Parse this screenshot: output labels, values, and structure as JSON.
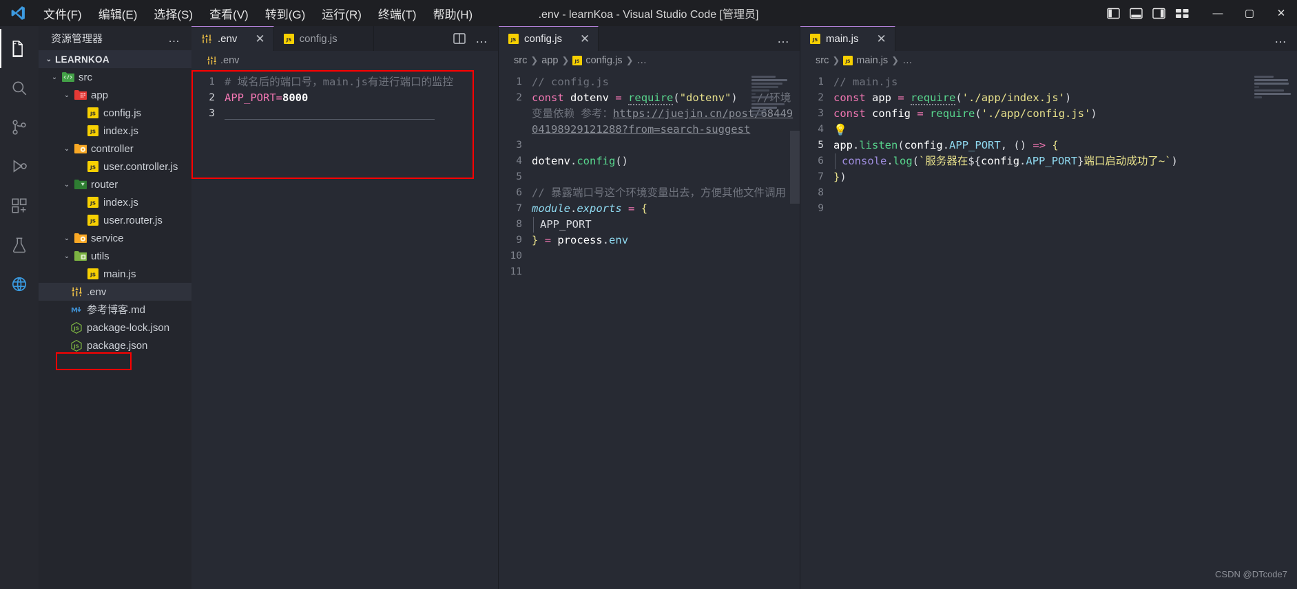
{
  "titlebar": {
    "app_icon": "vscode-logo-icon",
    "menus": [
      "文件(F)",
      "编辑(E)",
      "选择(S)",
      "查看(V)",
      "转到(G)",
      "运行(R)",
      "终端(T)",
      "帮助(H)"
    ],
    "window_title": ".env - learnKoa - Visual Studio Code [管理员]",
    "layout_icons": [
      "toggle-primary-sidebar-icon",
      "toggle-panel-icon",
      "toggle-secondary-sidebar-icon",
      "customize-layout-icon"
    ],
    "window_controls": {
      "minimize": "—",
      "maximize": "▢",
      "close": "✕"
    }
  },
  "activitybar": {
    "items": [
      {
        "name": "explorer",
        "icon": "files-icon",
        "active": true
      },
      {
        "name": "search",
        "icon": "search-icon",
        "active": false
      },
      {
        "name": "source-control",
        "icon": "source-control-icon",
        "active": false
      },
      {
        "name": "run-and-debug",
        "icon": "debug-icon",
        "active": false
      },
      {
        "name": "extensions",
        "icon": "extensions-icon",
        "active": false
      },
      {
        "name": "testing",
        "icon": "beaker-icon",
        "active": false
      },
      {
        "name": "remote-explorer",
        "icon": "remote-icon",
        "active": false
      }
    ]
  },
  "sidebar": {
    "title": "资源管理器",
    "more_actions": "…",
    "root": {
      "label": "LEARNKOA",
      "expanded": true
    },
    "tree": [
      {
        "label": "src",
        "type": "folder",
        "icon": "folder-src-icon",
        "indent": 1,
        "expanded": true
      },
      {
        "label": "app",
        "type": "folder",
        "icon": "folder-app-icon",
        "indent": 2,
        "expanded": true
      },
      {
        "label": "config.js",
        "type": "file",
        "icon": "js-file-icon",
        "indent": 3
      },
      {
        "label": "index.js",
        "type": "file",
        "icon": "js-file-icon",
        "indent": 3
      },
      {
        "label": "controller",
        "type": "folder",
        "icon": "folder-controller-icon",
        "indent": 2,
        "expanded": true
      },
      {
        "label": "user.controller.js",
        "type": "file",
        "icon": "js-file-icon",
        "indent": 3
      },
      {
        "label": "router",
        "type": "folder",
        "icon": "folder-router-icon",
        "indent": 2,
        "expanded": true
      },
      {
        "label": "index.js",
        "type": "file",
        "icon": "js-file-icon",
        "indent": 3
      },
      {
        "label": "user.router.js",
        "type": "file",
        "icon": "js-file-icon",
        "indent": 3
      },
      {
        "label": "service",
        "type": "folder",
        "icon": "folder-service-icon",
        "indent": 2,
        "expanded": true
      },
      {
        "label": "utils",
        "type": "folder",
        "icon": "folder-utils-icon",
        "indent": 2,
        "expanded": true
      },
      {
        "label": "main.js",
        "type": "file",
        "icon": "js-file-icon",
        "indent": 3
      },
      {
        "label": ".env",
        "type": "file",
        "icon": "env-tune-icon",
        "indent": 2,
        "selected": true,
        "highlighted": true
      },
      {
        "label": "参考博客.md",
        "type": "file",
        "icon": "markdown-icon",
        "indent": 2
      },
      {
        "label": "package-lock.json",
        "type": "file",
        "icon": "nodejs-json-icon",
        "indent": 2
      },
      {
        "label": "package.json",
        "type": "file",
        "icon": "nodejs-json-icon",
        "indent": 2
      }
    ]
  },
  "editor_groups": [
    {
      "id": "group-1",
      "tabs": [
        {
          "label": ".env",
          "icon": "env-tune-icon",
          "active": true,
          "close": "✕"
        },
        {
          "label": "config.js",
          "icon": "js-file-icon",
          "active": false,
          "close": "✕"
        }
      ],
      "actions": [
        "split-editor-icon",
        "more-actions-icon"
      ],
      "breadcrumb_icon": "env-tune-icon",
      "breadcrumb": [
        ".env"
      ],
      "highlighted": true,
      "lines": [
        {
          "no": "1",
          "text": "# 域名后的端口号，main.js有进行端口的监控"
        },
        {
          "no": "2",
          "text": "APP_PORT=8000"
        },
        {
          "no": "3",
          "text": ""
        }
      ]
    },
    {
      "id": "group-2",
      "tabs": [
        {
          "label": "config.js",
          "icon": "js-file-icon",
          "active": true,
          "close": "✕"
        }
      ],
      "actions": [
        "more-actions-icon"
      ],
      "breadcrumb": [
        "src",
        "app",
        "config.js",
        "…"
      ],
      "lines": [
        {
          "no": "1",
          "text": "// config.js"
        },
        {
          "no": "2",
          "text": "const dotenv = require(\"dotenv\")   //环境变量依赖 参考：https://juejin.cn/post/6844904198929121288?from=search-suggest"
        },
        {
          "no": "3",
          "text": ""
        },
        {
          "no": "4",
          "text": "dotenv.config()"
        },
        {
          "no": "5",
          "text": ""
        },
        {
          "no": "6",
          "text": "// 暴露端口号这个环境变量出去，方便其他文件调用"
        },
        {
          "no": "7",
          "text": "module.exports = {"
        },
        {
          "no": "8",
          "text": "  APP_PORT"
        },
        {
          "no": "9",
          "text": "} = process.env"
        },
        {
          "no": "10",
          "text": ""
        },
        {
          "no": "11",
          "text": ""
        }
      ]
    },
    {
      "id": "group-3",
      "tabs": [
        {
          "label": "main.js",
          "icon": "js-file-icon",
          "active": true,
          "close": "✕"
        }
      ],
      "actions": [
        "more-actions-icon"
      ],
      "breadcrumb": [
        "src",
        "main.js",
        "…"
      ],
      "lines": [
        {
          "no": "1",
          "text": "// main.js"
        },
        {
          "no": "2",
          "text": "const app = require('./app/index.js')"
        },
        {
          "no": "3",
          "text": "const config = require('./app/config.js')"
        },
        {
          "no": "4",
          "text": "💡"
        },
        {
          "no": "5",
          "text": "app.listen(config.APP_PORT, () => {"
        },
        {
          "no": "6",
          "text": "  console.log(`服务器在${config.APP_PORT}端口启动成功了~`)"
        },
        {
          "no": "7",
          "text": "})"
        },
        {
          "no": "8",
          "text": ""
        },
        {
          "no": "9",
          "text": ""
        }
      ]
    }
  ],
  "watermark": "CSDN @DTcode7",
  "colors": {
    "accent": "#b180d7",
    "highlight_box": "#ff0000",
    "editor_bg": "#272a33",
    "sidebar_bg": "#24262d",
    "titlebar_bg": "#1e1f23"
  }
}
